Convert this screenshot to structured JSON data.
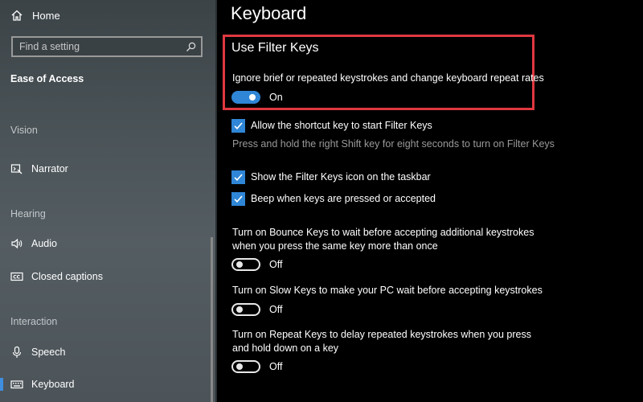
{
  "sidebar": {
    "home_label": "Home",
    "search_placeholder": "Find a setting",
    "section_title": "Ease of Access",
    "groups": {
      "vision": "Vision",
      "hearing": "Hearing",
      "interaction": "Interaction"
    },
    "items": {
      "narrator": "Narrator",
      "audio": "Audio",
      "closed_captions": "Closed captions",
      "speech": "Speech",
      "keyboard": "Keyboard"
    },
    "active_item": "Keyboard"
  },
  "main": {
    "page_title": "Keyboard",
    "filter_keys": {
      "title": "Use Filter Keys",
      "description": "Ignore brief or repeated keystrokes and change keyboard repeat rates",
      "toggle_state": "On"
    },
    "options": {
      "shortcut_label": "Allow the shortcut key to start Filter Keys",
      "shortcut_hint": "Press and hold the right Shift key for eight seconds to turn on Filter Keys",
      "taskbar_icon_label": "Show the Filter Keys icon on the taskbar",
      "beep_label": "Beep when keys are pressed or accepted"
    },
    "bounce_keys": {
      "text": "Turn on Bounce Keys to wait before accepting additional keystrokes when you press the same key more than once",
      "state": "Off"
    },
    "slow_keys": {
      "text": "Turn on Slow Keys to make your PC wait before accepting keystrokes",
      "state": "Off"
    },
    "repeat_keys": {
      "text": "Turn on Repeat Keys to delay repeated keystrokes when you press and hold down on a key",
      "state": "Off"
    }
  },
  "colors": {
    "accent": "#2f86d6",
    "highlight_border": "#e03840",
    "background": "#000000"
  }
}
